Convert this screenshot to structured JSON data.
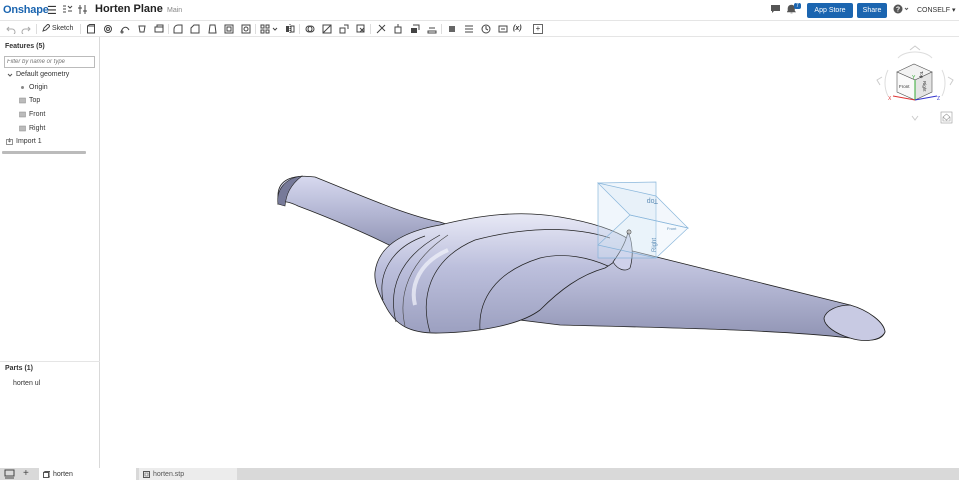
{
  "topbar": {
    "logo": "Onshape",
    "document_title": "Horten Plane",
    "workspace": "Main",
    "notification_count": "7",
    "app_store_label": "App Store",
    "share_label": "Share",
    "help_label": "?",
    "user_label": "CONSELF ▾"
  },
  "toolbar": {
    "sketch_label": "Sketch",
    "variable_label": "(x)",
    "add_label": "+"
  },
  "features": {
    "header": "Features (5)",
    "filter_placeholder": "Filter by name or type",
    "default_geometry": "Default geometry",
    "items": [
      "Origin",
      "Top",
      "Front",
      "Right"
    ],
    "import": "Import 1"
  },
  "parts": {
    "header": "Parts (1)",
    "items": [
      "horten ul"
    ]
  },
  "viewcube": {
    "faces": [
      "Front",
      "Right",
      "Top"
    ],
    "axes": [
      "X",
      "Y",
      "Z"
    ]
  },
  "planes": {
    "top": "Top",
    "right": "Right",
    "front": "Front"
  },
  "tabs": [
    {
      "label": "horten"
    },
    {
      "label": "horten.stp"
    }
  ],
  "colors": {
    "brand": "#1b65b0",
    "model_fill": "#b9bcd9"
  }
}
